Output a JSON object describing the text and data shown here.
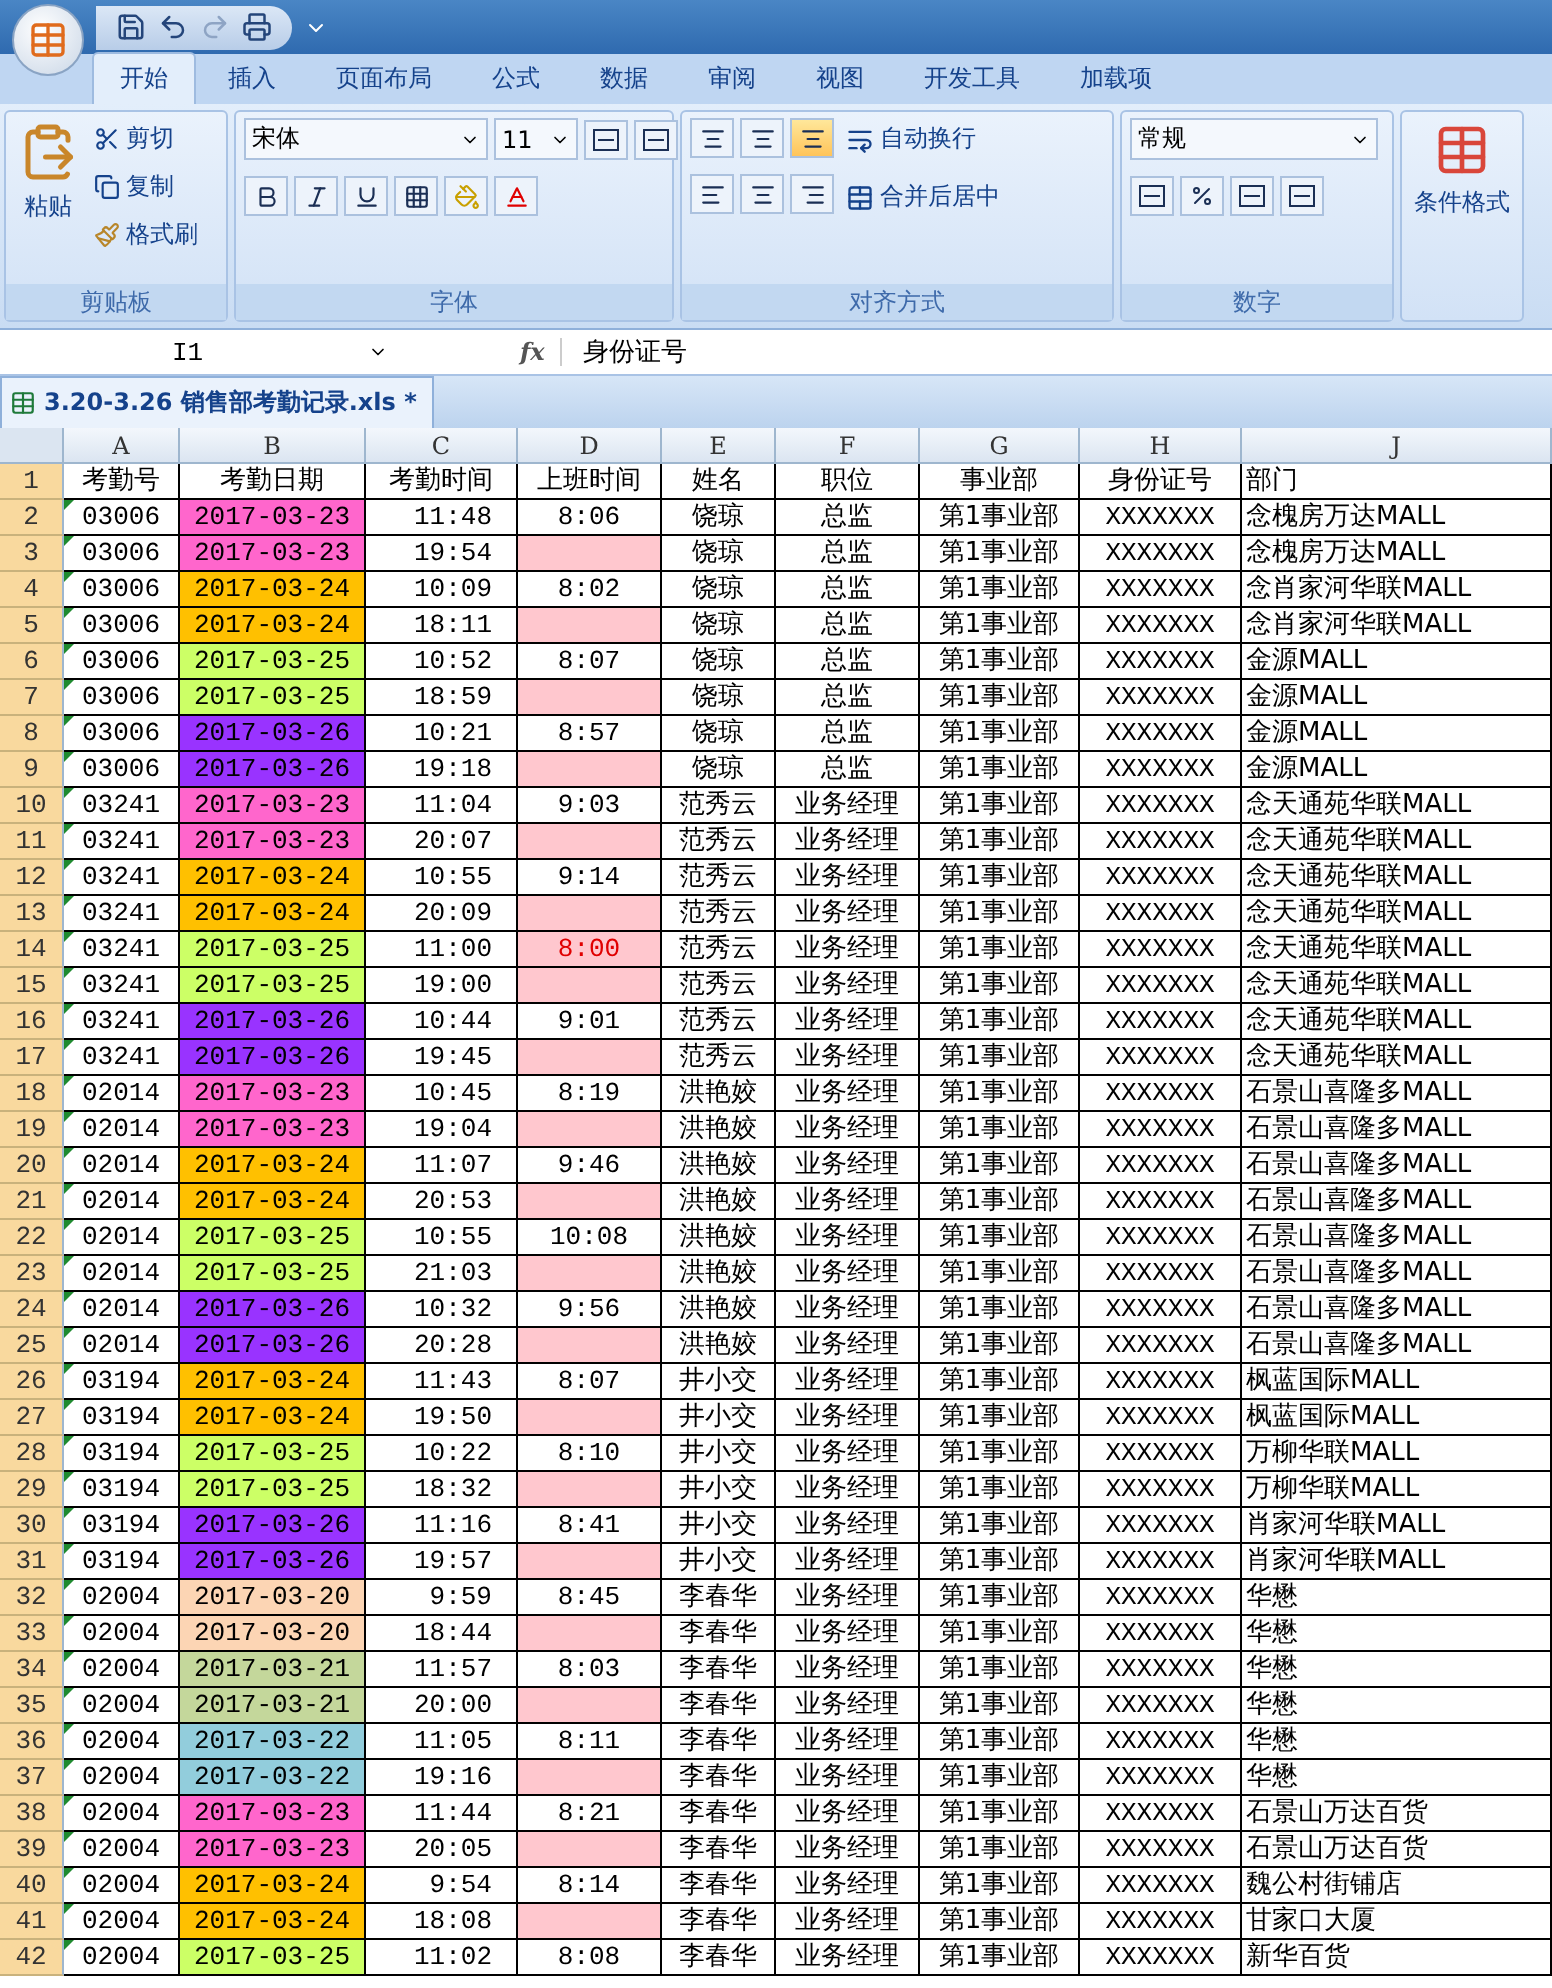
{
  "ribbon_tabs": [
    {
      "label": "开始",
      "selected": true
    },
    {
      "label": "插入",
      "selected": false
    },
    {
      "label": "页面布局",
      "selected": false
    },
    {
      "label": "公式",
      "selected": false
    },
    {
      "label": "数据",
      "selected": false
    },
    {
      "label": "审阅",
      "selected": false
    },
    {
      "label": "视图",
      "selected": false
    },
    {
      "label": "开发工具",
      "selected": false
    },
    {
      "label": "加载项",
      "selected": false
    }
  ],
  "clipboard": {
    "paste": "粘贴",
    "cut": "剪切",
    "copy": "复制",
    "format_painter": "格式刷",
    "title": "剪贴板"
  },
  "font": {
    "name": "宋体",
    "size": "11",
    "title": "字体"
  },
  "alignment": {
    "vertical": [
      {
        "selected": false
      },
      {
        "selected": false
      },
      {
        "selected": true
      }
    ],
    "wrap": "自动换行",
    "merge": "合并后居中",
    "title": "对齐方式"
  },
  "number": {
    "format": "常规",
    "title": "数字"
  },
  "styles": {
    "conditional": "条件格式"
  },
  "formula_bar": {
    "name_box": "I1",
    "fx": "fx",
    "formula": "身份证号"
  },
  "workbook_tab": "3.20-3.26 销售部考勤记录.xls *",
  "columns": [
    "A",
    "B",
    "C",
    "D",
    "E",
    "F",
    "G",
    "H",
    "J"
  ],
  "header": {
    "n": "1",
    "cells": [
      "考勤号",
      "考勤日期",
      "考勤时间",
      "上班时间",
      "姓名",
      "职位",
      "事业部",
      "身份证号",
      "部门"
    ]
  },
  "rows": [
    {
      "n": "2",
      "id": "03006",
      "date": "2017-03-23",
      "color": "#ff66cc",
      "time": "11:48",
      "start": "8:06",
      "flag": false,
      "name": "饶琼",
      "title": "总监",
      "dept": "第1事业部",
      "idno": "XXXXXXX",
      "store": "念槐房万达MALL"
    },
    {
      "n": "3",
      "id": "03006",
      "date": "2017-03-23",
      "color": "#ff66cc",
      "time": "19:54",
      "flag": true,
      "name": "饶琼",
      "title": "总监",
      "dept": "第1事业部",
      "idno": "XXXXXXX",
      "store": "念槐房万达MALL"
    },
    {
      "n": "4",
      "id": "03006",
      "date": "2017-03-24",
      "color": "#ffc000",
      "time": "10:09",
      "start": "8:02",
      "flag": false,
      "name": "饶琼",
      "title": "总监",
      "dept": "第1事业部",
      "idno": "XXXXXXX",
      "store": "念肖家河华联MALL"
    },
    {
      "n": "5",
      "id": "03006",
      "date": "2017-03-24",
      "color": "#ffc000",
      "time": "18:11",
      "flag": true,
      "name": "饶琼",
      "title": "总监",
      "dept": "第1事业部",
      "idno": "XXXXXXX",
      "store": "念肖家河华联MALL"
    },
    {
      "n": "6",
      "id": "03006",
      "date": "2017-03-25",
      "color": "#ccff66",
      "time": "10:52",
      "start": "8:07",
      "flag": false,
      "name": "饶琼",
      "title": "总监",
      "dept": "第1事业部",
      "idno": "XXXXXXX",
      "store": "金源MALL"
    },
    {
      "n": "7",
      "id": "03006",
      "date": "2017-03-25",
      "color": "#ccff66",
      "time": "18:59",
      "flag": true,
      "name": "饶琼",
      "title": "总监",
      "dept": "第1事业部",
      "idno": "XXXXXXX",
      "store": "金源MALL"
    },
    {
      "n": "8",
      "id": "03006",
      "date": "2017-03-26",
      "color": "#9933ff",
      "time": "10:21",
      "start": "8:57",
      "flag": false,
      "name": "饶琼",
      "title": "总监",
      "dept": "第1事业部",
      "idno": "XXXXXXX",
      "store": "金源MALL"
    },
    {
      "n": "9",
      "id": "03006",
      "date": "2017-03-26",
      "color": "#9933ff",
      "time": "19:18",
      "flag": true,
      "name": "饶琼",
      "title": "总监",
      "dept": "第1事业部",
      "idno": "XXXXXXX",
      "store": "金源MALL"
    },
    {
      "n": "10",
      "id": "03241",
      "date": "2017-03-23",
      "color": "#ff66cc",
      "time": "11:04",
      "start": "9:03",
      "flag": false,
      "name": "范秀云",
      "title": "业务经理",
      "dept": "第1事业部",
      "idno": "XXXXXXX",
      "store": "念天通苑华联MALL"
    },
    {
      "n": "11",
      "id": "03241",
      "date": "2017-03-23",
      "color": "#ff66cc",
      "time": "20:07",
      "flag": true,
      "name": "范秀云",
      "title": "业务经理",
      "dept": "第1事业部",
      "idno": "XXXXXXX",
      "store": "念天通苑华联MALL"
    },
    {
      "n": "12",
      "id": "03241",
      "date": "2017-03-24",
      "color": "#ffc000",
      "time": "10:55",
      "start": "9:14",
      "flag": false,
      "name": "范秀云",
      "title": "业务经理",
      "dept": "第1事业部",
      "idno": "XXXXXXX",
      "store": "念天通苑华联MALL"
    },
    {
      "n": "13",
      "id": "03241",
      "date": "2017-03-24",
      "color": "#ffc000",
      "time": "20:09",
      "flag": true,
      "name": "范秀云",
      "title": "业务经理",
      "dept": "第1事业部",
      "idno": "XXXXXXX",
      "store": "念天通苑华联MALL"
    },
    {
      "n": "14",
      "id": "03241",
      "date": "2017-03-25",
      "color": "#ccff66",
      "time": "11:00",
      "start": "8:00",
      "flag": true,
      "name": "范秀云",
      "title": "业务经理",
      "dept": "第1事业部",
      "idno": "XXXXXXX",
      "store": "念天通苑华联MALL"
    },
    {
      "n": "15",
      "id": "03241",
      "date": "2017-03-25",
      "color": "#ccff66",
      "time": "19:00",
      "flag": true,
      "name": "范秀云",
      "title": "业务经理",
      "dept": "第1事业部",
      "idno": "XXXXXXX",
      "store": "念天通苑华联MALL"
    },
    {
      "n": "16",
      "id": "03241",
      "date": "2017-03-26",
      "color": "#9933ff",
      "time": "10:44",
      "start": "9:01",
      "flag": false,
      "name": "范秀云",
      "title": "业务经理",
      "dept": "第1事业部",
      "idno": "XXXXXXX",
      "store": "念天通苑华联MALL"
    },
    {
      "n": "17",
      "id": "03241",
      "date": "2017-03-26",
      "color": "#9933ff",
      "time": "19:45",
      "flag": true,
      "name": "范秀云",
      "title": "业务经理",
      "dept": "第1事业部",
      "idno": "XXXXXXX",
      "store": "念天通苑华联MALL"
    },
    {
      "n": "18",
      "id": "02014",
      "date": "2017-03-23",
      "color": "#ff66cc",
      "time": "10:45",
      "start": "8:19",
      "flag": false,
      "name": "洪艳姣",
      "title": "业务经理",
      "dept": "第1事业部",
      "idno": "XXXXXXX",
      "store": "石景山喜隆多MALL"
    },
    {
      "n": "19",
      "id": "02014",
      "date": "2017-03-23",
      "color": "#ff66cc",
      "time": "19:04",
      "flag": true,
      "name": "洪艳姣",
      "title": "业务经理",
      "dept": "第1事业部",
      "idno": "XXXXXXX",
      "store": "石景山喜隆多MALL"
    },
    {
      "n": "20",
      "id": "02014",
      "date": "2017-03-24",
      "color": "#ffc000",
      "time": "11:07",
      "start": "9:46",
      "flag": false,
      "name": "洪艳姣",
      "title": "业务经理",
      "dept": "第1事业部",
      "idno": "XXXXXXX",
      "store": "石景山喜隆多MALL"
    },
    {
      "n": "21",
      "id": "02014",
      "date": "2017-03-24",
      "color": "#ffc000",
      "time": "20:53",
      "flag": true,
      "name": "洪艳姣",
      "title": "业务经理",
      "dept": "第1事业部",
      "idno": "XXXXXXX",
      "store": "石景山喜隆多MALL"
    },
    {
      "n": "22",
      "id": "02014",
      "date": "2017-03-25",
      "color": "#ccff66",
      "time": "10:55",
      "start": "10:08",
      "flag": false,
      "name": "洪艳姣",
      "title": "业务经理",
      "dept": "第1事业部",
      "idno": "XXXXXXX",
      "store": "石景山喜隆多MALL"
    },
    {
      "n": "23",
      "id": "02014",
      "date": "2017-03-25",
      "color": "#ccff66",
      "time": "21:03",
      "flag": true,
      "name": "洪艳姣",
      "title": "业务经理",
      "dept": "第1事业部",
      "idno": "XXXXXXX",
      "store": "石景山喜隆多MALL"
    },
    {
      "n": "24",
      "id": "02014",
      "date": "2017-03-26",
      "color": "#9933ff",
      "time": "10:32",
      "start": "9:56",
      "flag": false,
      "name": "洪艳姣",
      "title": "业务经理",
      "dept": "第1事业部",
      "idno": "XXXXXXX",
      "store": "石景山喜隆多MALL"
    },
    {
      "n": "25",
      "id": "02014",
      "date": "2017-03-26",
      "color": "#9933ff",
      "time": "20:28",
      "flag": true,
      "name": "洪艳姣",
      "title": "业务经理",
      "dept": "第1事业部",
      "idno": "XXXXXXX",
      "store": "石景山喜隆多MALL"
    },
    {
      "n": "26",
      "id": "03194",
      "date": "2017-03-24",
      "color": "#ffc000",
      "time": "11:43",
      "start": "8:07",
      "flag": false,
      "name": "井小交",
      "title": "业务经理",
      "dept": "第1事业部",
      "idno": "XXXXXXX",
      "store": "枫蓝国际MALL"
    },
    {
      "n": "27",
      "id": "03194",
      "date": "2017-03-24",
      "color": "#ffc000",
      "time": "19:50",
      "flag": true,
      "name": "井小交",
      "title": "业务经理",
      "dept": "第1事业部",
      "idno": "XXXXXXX",
      "store": "枫蓝国际MALL"
    },
    {
      "n": "28",
      "id": "03194",
      "date": "2017-03-25",
      "color": "#ccff66",
      "time": "10:22",
      "start": "8:10",
      "flag": false,
      "name": "井小交",
      "title": "业务经理",
      "dept": "第1事业部",
      "idno": "XXXXXXX",
      "store": "万柳华联MALL"
    },
    {
      "n": "29",
      "id": "03194",
      "date": "2017-03-25",
      "color": "#ccff66",
      "time": "18:32",
      "flag": true,
      "name": "井小交",
      "title": "业务经理",
      "dept": "第1事业部",
      "idno": "XXXXXXX",
      "store": "万柳华联MALL"
    },
    {
      "n": "30",
      "id": "03194",
      "date": "2017-03-26",
      "color": "#9933ff",
      "time": "11:16",
      "start": "8:41",
      "flag": false,
      "name": "井小交",
      "title": "业务经理",
      "dept": "第1事业部",
      "idno": "XXXXXXX",
      "store": "肖家河华联MALL"
    },
    {
      "n": "31",
      "id": "03194",
      "date": "2017-03-26",
      "color": "#9933ff",
      "time": "19:57",
      "flag": true,
      "name": "井小交",
      "title": "业务经理",
      "dept": "第1事业部",
      "idno": "XXXXXXX",
      "store": "肖家河华联MALL"
    },
    {
      "n": "32",
      "id": "02004",
      "date": "2017-03-20",
      "color": "#fcd5b4",
      "time": "9:59",
      "start": "8:45",
      "flag": false,
      "name": "李春华",
      "title": "业务经理",
      "dept": "第1事业部",
      "idno": "XXXXXXX",
      "store": "华懋"
    },
    {
      "n": "33",
      "id": "02004",
      "date": "2017-03-20",
      "color": "#fcd5b4",
      "time": "18:44",
      "flag": true,
      "name": "李春华",
      "title": "业务经理",
      "dept": "第1事业部",
      "idno": "XXXXXXX",
      "store": "华懋"
    },
    {
      "n": "34",
      "id": "02004",
      "date": "2017-03-21",
      "color": "#c4d79b",
      "time": "11:57",
      "start": "8:03",
      "flag": false,
      "name": "李春华",
      "title": "业务经理",
      "dept": "第1事业部",
      "idno": "XXXXXXX",
      "store": "华懋"
    },
    {
      "n": "35",
      "id": "02004",
      "date": "2017-03-21",
      "color": "#c4d79b",
      "time": "20:00",
      "flag": true,
      "name": "李春华",
      "title": "业务经理",
      "dept": "第1事业部",
      "idno": "XXXXXXX",
      "store": "华懋"
    },
    {
      "n": "36",
      "id": "02004",
      "date": "2017-03-22",
      "color": "#92cddc",
      "time": "11:05",
      "start": "8:11",
      "flag": false,
      "name": "李春华",
      "title": "业务经理",
      "dept": "第1事业部",
      "idno": "XXXXXXX",
      "store": "华懋"
    },
    {
      "n": "37",
      "id": "02004",
      "date": "2017-03-22",
      "color": "#92cddc",
      "time": "19:16",
      "flag": true,
      "name": "李春华",
      "title": "业务经理",
      "dept": "第1事业部",
      "idno": "XXXXXXX",
      "store": "华懋"
    },
    {
      "n": "38",
      "id": "02004",
      "date": "2017-03-23",
      "color": "#ff66cc",
      "time": "11:44",
      "start": "8:21",
      "flag": false,
      "name": "李春华",
      "title": "业务经理",
      "dept": "第1事业部",
      "idno": "XXXXXXX",
      "store": "石景山万达百货"
    },
    {
      "n": "39",
      "id": "02004",
      "date": "2017-03-23",
      "color": "#ff66cc",
      "time": "20:05",
      "flag": true,
      "name": "李春华",
      "title": "业务经理",
      "dept": "第1事业部",
      "idno": "XXXXXXX",
      "store": "石景山万达百货"
    },
    {
      "n": "40",
      "id": "02004",
      "date": "2017-03-24",
      "color": "#ffc000",
      "time": "9:54",
      "start": "8:14",
      "flag": false,
      "name": "李春华",
      "title": "业务经理",
      "dept": "第1事业部",
      "idno": "XXXXXXX",
      "store": "魏公村街铺店"
    },
    {
      "n": "41",
      "id": "02004",
      "date": "2017-03-24",
      "color": "#ffc000",
      "time": "18:08",
      "flag": true,
      "name": "李春华",
      "title": "业务经理",
      "dept": "第1事业部",
      "idno": "XXXXXXX",
      "store": "甘家口大厦"
    },
    {
      "n": "42",
      "id": "02004",
      "date": "2017-03-25",
      "color": "#ccff66",
      "time": "11:02",
      "start": "8:08",
      "flag": false,
      "name": "李春华",
      "title": "业务经理",
      "dept": "第1事业部",
      "idno": "XXXXXXX",
      "store": "新华百货"
    }
  ]
}
